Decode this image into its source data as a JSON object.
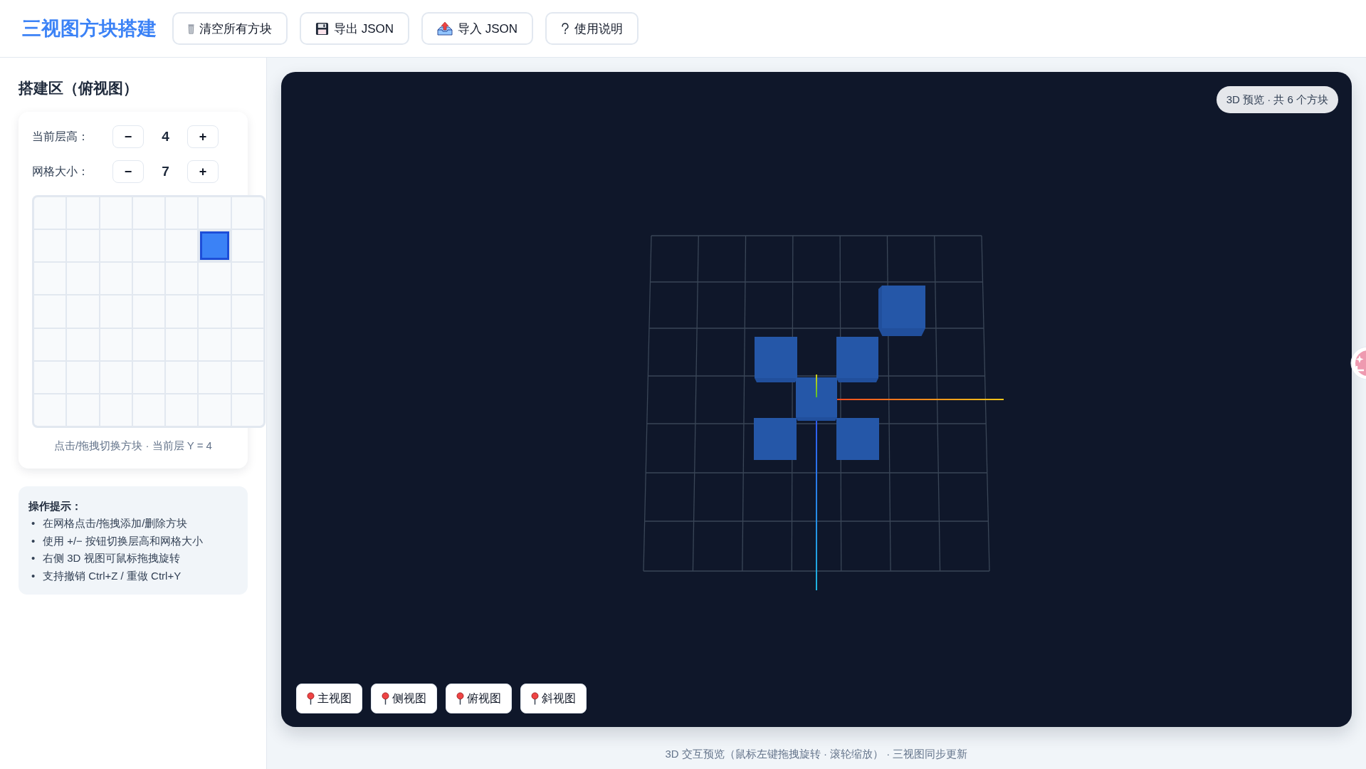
{
  "header": {
    "title": "三视图方块搭建",
    "buttons": [
      {
        "kind": "trash",
        "label": "清空所有方块"
      },
      {
        "kind": "save",
        "label": "导出 JSON"
      },
      {
        "kind": "import",
        "label": "导入 JSON"
      },
      {
        "kind": "help",
        "label": "使用说明"
      }
    ]
  },
  "sidebar": {
    "title": "搭建区（俯视图）",
    "controls": [
      {
        "label": "当前层高：",
        "decrement": "−",
        "value": "4",
        "increment": "+"
      },
      {
        "label": "网格大小：",
        "decrement": "−",
        "value": "7",
        "increment": "+"
      }
    ],
    "grid": {
      "rows": [
        {
          "cells": [
            {
              "filled": false
            },
            {
              "filled": false
            },
            {
              "filled": false
            },
            {
              "filled": false
            },
            {
              "filled": false
            },
            {
              "filled": false
            },
            {
              "filled": false
            }
          ]
        },
        {
          "cells": [
            {
              "filled": false
            },
            {
              "filled": false
            },
            {
              "filled": false
            },
            {
              "filled": false
            },
            {
              "filled": false
            },
            {
              "filled": true
            },
            {
              "filled": false
            }
          ]
        },
        {
          "cells": [
            {
              "filled": false
            },
            {
              "filled": false
            },
            {
              "filled": false
            },
            {
              "filled": false
            },
            {
              "filled": false
            },
            {
              "filled": false
            },
            {
              "filled": false
            }
          ]
        },
        {
          "cells": [
            {
              "filled": false
            },
            {
              "filled": false
            },
            {
              "filled": false
            },
            {
              "filled": false
            },
            {
              "filled": false
            },
            {
              "filled": false
            },
            {
              "filled": false
            }
          ]
        },
        {
          "cells": [
            {
              "filled": false
            },
            {
              "filled": false
            },
            {
              "filled": false
            },
            {
              "filled": false
            },
            {
              "filled": false
            },
            {
              "filled": false
            },
            {
              "filled": false
            }
          ]
        },
        {
          "cells": [
            {
              "filled": false
            },
            {
              "filled": false
            },
            {
              "filled": false
            },
            {
              "filled": false
            },
            {
              "filled": false
            },
            {
              "filled": false
            },
            {
              "filled": false
            }
          ]
        },
        {
          "cells": [
            {
              "filled": false
            },
            {
              "filled": false
            },
            {
              "filled": false
            },
            {
              "filled": false
            },
            {
              "filled": false
            },
            {
              "filled": false
            },
            {
              "filled": false
            }
          ]
        }
      ]
    },
    "caption": "点击/拖拽切换方块 · 当前层 Y = 4",
    "tips": {
      "title": "操作提示：",
      "items": [
        {
          "marker": "•",
          "text": "在网格点击/拖拽添加/删除方块"
        },
        {
          "marker": "•",
          "text": "使用 +/− 按钮切换层高和网格大小"
        },
        {
          "marker": "•",
          "text": "右侧 3D 视图可鼠标拖拽旋转"
        },
        {
          "marker": "•",
          "text": "支持撤销 Ctrl+Z / 重做 Ctrl+Y"
        }
      ]
    }
  },
  "preview": {
    "badge": "3D 预览 · 共 6 个方块",
    "view_buttons": [
      {
        "label": "主视图"
      },
      {
        "label": "侧视图"
      },
      {
        "label": "俯视图"
      },
      {
        "label": "斜视图"
      }
    ]
  },
  "footer": "3D 交互预览（鼠标左键拖拽旋转 · 滚轮缩放） · 三视图同步更新"
}
